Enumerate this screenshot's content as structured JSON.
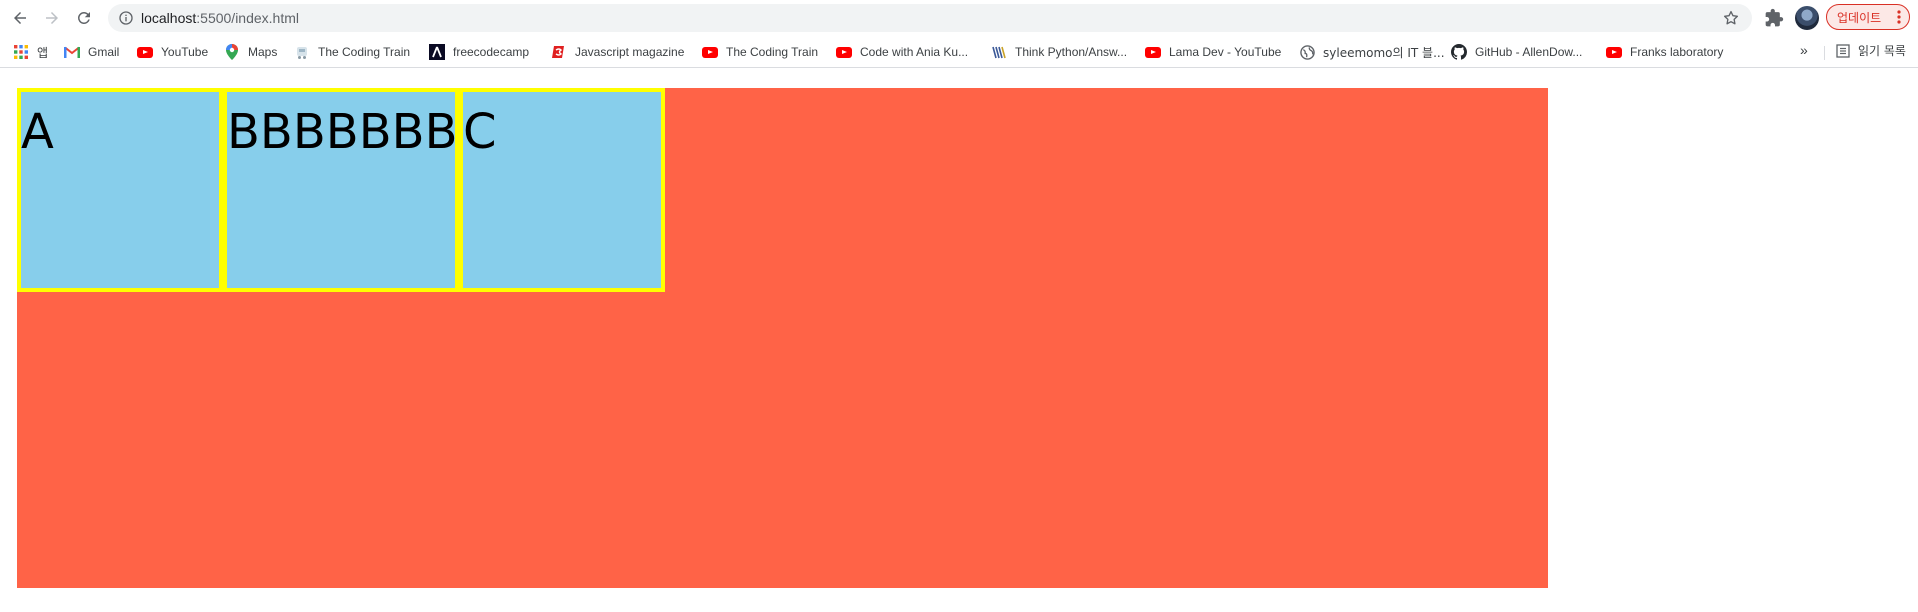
{
  "browser": {
    "url_host": "localhost",
    "url_path": ":5500/index.html",
    "update_label": "업데이트"
  },
  "bookmarks": [
    {
      "label": "앱",
      "icon": "apps-grid-icon"
    },
    {
      "label": "Gmail",
      "icon": "gmail-icon"
    },
    {
      "label": "YouTube",
      "icon": "youtube-icon"
    },
    {
      "label": "Maps",
      "icon": "maps-pin-icon"
    },
    {
      "label": "The Coding Train",
      "icon": "coding-train-icon"
    },
    {
      "label": "freecodecamp",
      "icon": "freecodecamp-icon"
    },
    {
      "label": "Javascript magazine",
      "icon": "javascript-magazine-icon"
    },
    {
      "label": "The Coding Train",
      "icon": "youtube-icon"
    },
    {
      "label": "Code with Ania Ku...",
      "icon": "youtube-icon"
    },
    {
      "label": "Think Python/Answ...",
      "icon": "think-python-icon"
    },
    {
      "label": "Lama Dev - YouTube",
      "icon": "youtube-icon"
    },
    {
      "label": "syleemomo의 IT 블...",
      "icon": "globe-icon"
    },
    {
      "label": "GitHub - AllenDow...",
      "icon": "github-icon"
    },
    {
      "label": "Franks laboratory",
      "icon": "youtube-icon"
    }
  ],
  "reading_list_label": "읽기 목록",
  "page": {
    "items": [
      {
        "label": "A"
      },
      {
        "label": "BBBBBBB"
      },
      {
        "label": "C"
      }
    ],
    "colors": {
      "container": "#ff6347",
      "item_bg": "#87ceeb",
      "item_border": "#ffff00"
    }
  }
}
